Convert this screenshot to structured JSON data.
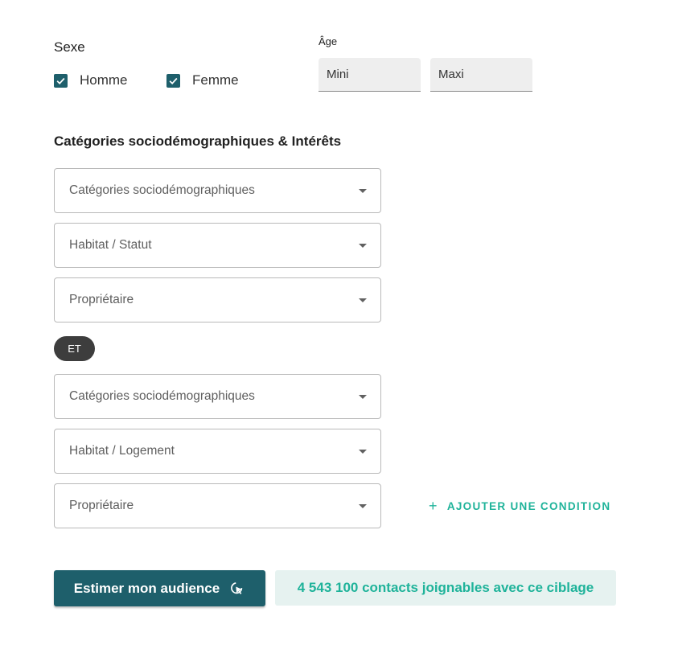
{
  "sexe": {
    "label": "Sexe",
    "options": [
      {
        "label": "Homme",
        "checked": true
      },
      {
        "label": "Femme",
        "checked": true
      }
    ]
  },
  "age": {
    "label": "Âge",
    "min_placeholder": "Mini",
    "max_placeholder": "Maxi"
  },
  "categories": {
    "title": "Catégories sociodémographiques & Intérêts",
    "group1": [
      "Catégories sociodémographiques",
      "Habitat / Statut",
      "Propriétaire"
    ],
    "operator": "ET",
    "group2": [
      "Catégories sociodémographiques",
      "Habitat / Logement",
      "Propriétaire"
    ],
    "add_condition": "AJOUTER UNE CONDITION"
  },
  "footer": {
    "estimate_button": "Estimer mon audience",
    "result_text": "4 543 100 contacts joignables avec ce ciblage"
  },
  "colors": {
    "primary": "#1e5f6b",
    "accent": "#1fb39a",
    "result_bg": "#e6f2f0"
  }
}
